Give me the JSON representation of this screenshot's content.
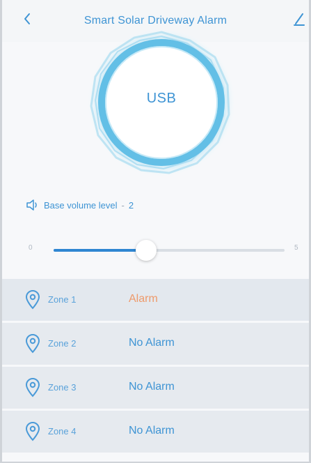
{
  "header": {
    "title": "Smart Solar Driveway Alarm",
    "back_icon": "chevron-left-icon",
    "edit_icon": "pencil-icon"
  },
  "status": {
    "label": "USB"
  },
  "volume": {
    "icon": "speaker-icon",
    "label": "Base volume level",
    "separator": "-",
    "value": "2"
  },
  "slider": {
    "min_label": "0",
    "max_label": "5",
    "level": 2,
    "max": 5
  },
  "zones": [
    {
      "name": "Zone 1",
      "status": "Alarm",
      "state": "alarm"
    },
    {
      "name": "Zone 2",
      "status": "No Alarm",
      "state": "ok"
    },
    {
      "name": "Zone 3",
      "status": "No Alarm",
      "state": "ok"
    },
    {
      "name": "Zone 4",
      "status": "No Alarm",
      "state": "ok"
    }
  ],
  "colors": {
    "accent": "#3e94d4",
    "alarm": "#ee9a6b",
    "ring": "#6ec3e6"
  }
}
